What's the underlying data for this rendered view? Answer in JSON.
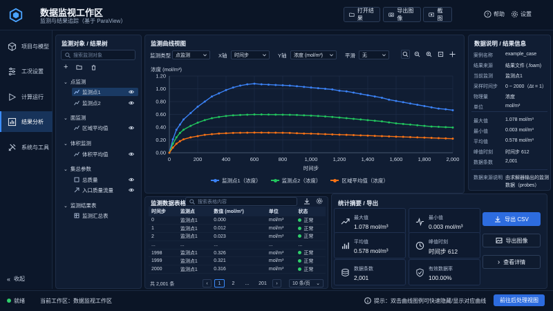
{
  "app": {
    "title": "数据监视工作区",
    "subtitle": "监测与结果追踪（基于 ParaView）"
  },
  "header": {
    "open_result": "打开结果",
    "export_image": "导出图像",
    "screenshot": "截图",
    "help": "帮助",
    "settings": "设置"
  },
  "sidebar": {
    "items": [
      {
        "label": "项目与模型",
        "icon": "cube-icon"
      },
      {
        "label": "工况设置",
        "icon": "sliders-icon"
      },
      {
        "label": "计算运行",
        "icon": "play-icon"
      },
      {
        "label": "结果分析",
        "icon": "bar-chart-icon"
      },
      {
        "label": "系统与工具",
        "icon": "tools-icon"
      }
    ],
    "collapse": "收起"
  },
  "tree": {
    "title": "监测对象 / 结果树",
    "search_placeholder": "搜索监测对象",
    "groups": [
      {
        "label": "点监测",
        "children": [
          "监测点1",
          "监测点2"
        ]
      },
      {
        "label": "面监测",
        "children": [
          "区域平均值"
        ]
      },
      {
        "label": "体积监测",
        "children": [
          "体积平均值"
        ]
      },
      {
        "label": "集总参数",
        "children": [
          "总质量",
          "入口质量流量"
        ]
      },
      {
        "label": "监测结果表",
        "children": [
          "监测汇总表"
        ]
      }
    ]
  },
  "chart_panel": {
    "title": "监测曲线视图",
    "type_label": "监测类型",
    "type_value": "点监测",
    "x_label": "X轴",
    "x_value": "时间步",
    "y_label": "Y轴",
    "y_value": "浓度 (mol/m³)",
    "smooth_label": "平滑",
    "smooth_value": "无"
  },
  "chart_data": {
    "type": "line",
    "xlabel": "时间步",
    "ylabel": "浓度 (mol/m³)",
    "xlim": [
      0,
      2000
    ],
    "ylim": [
      0,
      1.2
    ],
    "xticks": [
      0,
      200,
      400,
      600,
      800,
      1000,
      1200,
      1400,
      1600,
      1800,
      2000
    ],
    "yticks": [
      0.0,
      0.2,
      0.4,
      0.6,
      0.8,
      1.0,
      1.2
    ],
    "ytick_labels": [
      "0.00",
      "0.20",
      "0.40",
      "0.60",
      "0.80",
      "1.00",
      "1.20"
    ],
    "xtick_labels": [
      "0",
      "200",
      "400",
      "600",
      "800",
      "1,000",
      "1,200",
      "1,400",
      "1,600",
      "1,800",
      "2,000"
    ],
    "grid": true,
    "legend_position": "bottom",
    "x": [
      0,
      25,
      50,
      75,
      100,
      150,
      200,
      250,
      300,
      350,
      400,
      450,
      500,
      550,
      600,
      650,
      700,
      750,
      800,
      850,
      900,
      950,
      1000,
      1050,
      1100,
      1150,
      1200,
      1250,
      1300,
      1350,
      1400,
      1450,
      1500,
      1550,
      1600,
      1650,
      1700,
      1750,
      1800,
      1850,
      1900,
      1950,
      2000
    ],
    "series": [
      {
        "name": "监测点1（浓度）",
        "color": "#3b82f6",
        "values": [
          0.0,
          0.21,
          0.36,
          0.44,
          0.52,
          0.62,
          0.72,
          0.8,
          0.88,
          0.93,
          0.98,
          1.02,
          1.05,
          1.07,
          1.08,
          1.07,
          1.065,
          1.06,
          1.055,
          1.05,
          1.04,
          1.03,
          1.02,
          1.01,
          1.0,
          0.99,
          0.97,
          0.96,
          0.94,
          0.92,
          0.9,
          0.88,
          0.86,
          0.83,
          0.81,
          0.79,
          0.77,
          0.75,
          0.73,
          0.71,
          0.69,
          0.68,
          0.665
        ]
      },
      {
        "name": "监测点2（浓度）",
        "color": "#22c55e",
        "values": [
          0.0,
          0.14,
          0.24,
          0.31,
          0.36,
          0.42,
          0.47,
          0.51,
          0.54,
          0.56,
          0.575,
          0.585,
          0.59,
          0.595,
          0.598,
          0.598,
          0.597,
          0.596,
          0.595,
          0.593,
          0.59,
          0.585,
          0.58,
          0.575,
          0.568,
          0.56,
          0.55,
          0.54,
          0.53,
          0.52,
          0.51,
          0.5,
          0.49,
          0.475,
          0.46,
          0.45,
          0.44,
          0.43,
          0.42,
          0.41,
          0.405,
          0.4,
          0.395
        ]
      },
      {
        "name": "区域平均值（浓度）",
        "color": "#f97316",
        "values": [
          0.0,
          0.08,
          0.14,
          0.18,
          0.21,
          0.24,
          0.26,
          0.28,
          0.29,
          0.3,
          0.305,
          0.31,
          0.312,
          0.314,
          0.315,
          0.315,
          0.314,
          0.313,
          0.312,
          0.31,
          0.305,
          0.3,
          0.298,
          0.295,
          0.29,
          0.287,
          0.283,
          0.28,
          0.276,
          0.272,
          0.268,
          0.264,
          0.26,
          0.256,
          0.252,
          0.248,
          0.244,
          0.24,
          0.236,
          0.232,
          0.228,
          0.224,
          0.22
        ]
      }
    ]
  },
  "table": {
    "title": "监测数据表格",
    "search_placeholder": "搜索表格内容",
    "columns": [
      "时间步",
      "监测点",
      "数值 (mol/m³)",
      "单位",
      "状态"
    ],
    "rows": [
      [
        "0",
        "监测点1",
        "0.000",
        "mol/m³",
        "正常"
      ],
      [
        "1",
        "监测点1",
        "0.012",
        "mol/m³",
        "正常"
      ],
      [
        "2",
        "监测点1",
        "0.023",
        "mol/m³",
        "正常"
      ],
      [
        "...",
        "...",
        "...",
        "...",
        "..."
      ],
      [
        "1998",
        "监测点1",
        "0.326",
        "mol/m³",
        "正常"
      ],
      [
        "1999",
        "监测点1",
        "0.321",
        "mol/m³",
        "正常"
      ],
      [
        "2000",
        "监测点1",
        "0.316",
        "mol/m³",
        "正常"
      ]
    ],
    "total": "共 2,001 条",
    "pages": [
      "1",
      "2",
      "...",
      "201"
    ],
    "page_size": "10 条/页"
  },
  "stats": {
    "title": "统计摘要 / 导出",
    "cards": [
      {
        "label": "最大值",
        "value": "1.078 mol/m³",
        "icon": "trend-up-icon"
      },
      {
        "label": "最小值",
        "value": "0.003 mol/m³",
        "icon": "pulse-icon"
      },
      {
        "label": "平均值",
        "value": "0.578 mol/m³",
        "icon": "bars-icon"
      },
      {
        "label": "峰值时刻",
        "value": "时间步 612",
        "icon": "clock-icon"
      },
      {
        "label": "数据条数",
        "value": "2,001",
        "icon": "database-icon"
      },
      {
        "label": "有效数据率",
        "value": "100.00%",
        "icon": "shield-check-icon"
      }
    ],
    "export_csv": "导出 CSV",
    "export_image": "导出图像",
    "view_detail": "查看详情"
  },
  "info": {
    "title": "数据说明 / 结果信息",
    "rows": [
      {
        "k": "案例名称",
        "v": "example_case"
      },
      {
        "k": "结果来源",
        "v": "结果文件 (.foam)"
      },
      {
        "k": "当前监测",
        "v": "监测点1"
      },
      {
        "k": "采样时间步",
        "v": "0 ~ 2000（Δt = 1）"
      },
      {
        "k": "物理量",
        "v": "浓度"
      },
      {
        "k": "单位",
        "v": "mol/m³"
      }
    ],
    "rows2": [
      {
        "k": "最大值",
        "v": "1.078 mol/m³"
      },
      {
        "k": "最小值",
        "v": "0.003 mol/m³"
      },
      {
        "k": "平均值",
        "v": "0.578 mol/m³"
      },
      {
        "k": "峰值时刻",
        "v": "时间步 612"
      },
      {
        "k": "数据条数",
        "v": "2,001"
      }
    ],
    "source_k": "数据来源说明",
    "source_v1": "由求解器输出的监测",
    "source_v2": "数据（probes）"
  },
  "footer": {
    "status": "就绪",
    "workspace": "当前工作区：数据监视工作区",
    "tip": "提示：双击曲线图例可快速隐藏/显示对应曲线",
    "goto_button": "前往后处理视图"
  }
}
